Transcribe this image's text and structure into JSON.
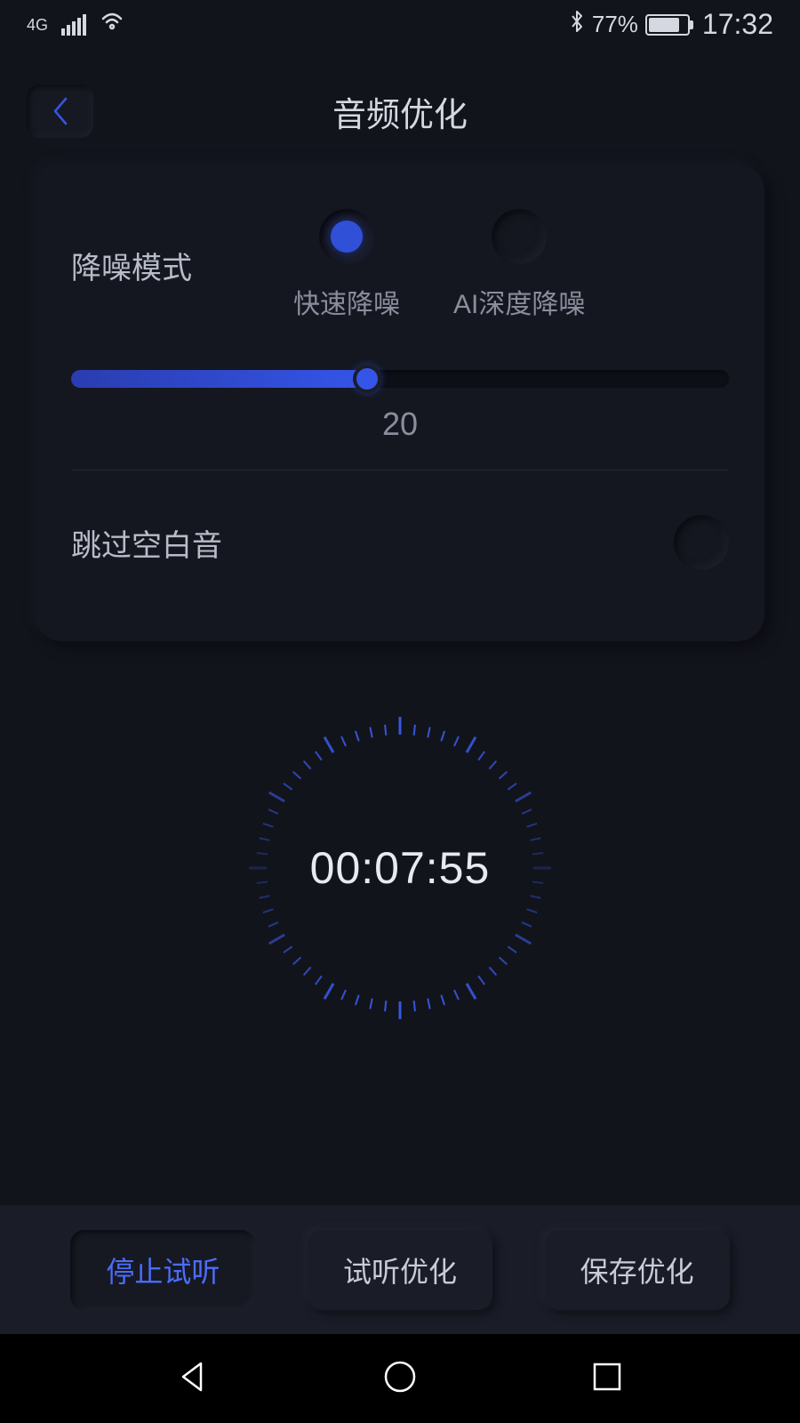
{
  "statusBar": {
    "network": "4G",
    "batteryPercent": "77%",
    "time": "17:32"
  },
  "header": {
    "title": "音频优化"
  },
  "noiseReduction": {
    "label": "降噪模式",
    "options": {
      "fast": "快速降噪",
      "aiDeep": "AI深度降噪"
    },
    "selected": "fast",
    "sliderValue": "20"
  },
  "skipSilence": {
    "label": "跳过空白音",
    "enabled": false
  },
  "timer": {
    "display": "00:07:55"
  },
  "actions": {
    "stopPreview": "停止试听",
    "previewOptimize": "试听优化",
    "saveOptimize": "保存优化"
  }
}
